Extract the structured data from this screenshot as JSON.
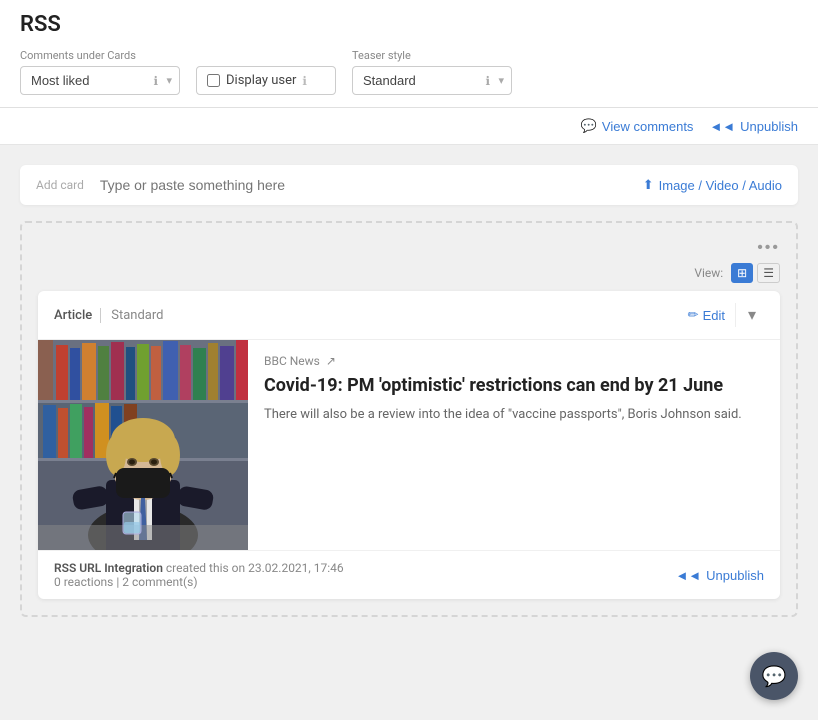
{
  "page": {
    "title": "RSS"
  },
  "topbar": {
    "comments_label": "Comments under Cards",
    "comments_value": "Most liked",
    "display_user_label": "Display user",
    "teaser_label": "Teaser style",
    "teaser_value": "Standard",
    "info_icon": "ℹ",
    "chevron": "▾"
  },
  "actions": {
    "view_comments": "View comments",
    "unpublish": "Unpublish",
    "comment_icon": "💬",
    "rewind_icon": "◄◄"
  },
  "add_card": {
    "label": "Add\ncard",
    "placeholder": "Type or paste something here",
    "upload_label": "Image / Video / Audio",
    "upload_icon": "⬆"
  },
  "view": {
    "label": "View:",
    "grid_active": true
  },
  "article": {
    "type": "Article",
    "standard": "Standard",
    "edit_label": "Edit",
    "source": "BBC News",
    "external_icon": "↗",
    "title": "Covid-19: PM 'optimistic' restrictions can end by 21 June",
    "description": "There will also be a review into the idea of \"vaccine passports\", Boris Johnson said.",
    "footer_meta_creator": "RSS URL Integration",
    "footer_meta_action": "created this on",
    "footer_meta_date": "23.02.2021, 17:46",
    "footer_reactions": "0 reactions",
    "footer_comments": "2 comment(s)",
    "unpublish_label": "Unpublish",
    "rewind_icon": "◄◄"
  },
  "dots_menu": "•••"
}
